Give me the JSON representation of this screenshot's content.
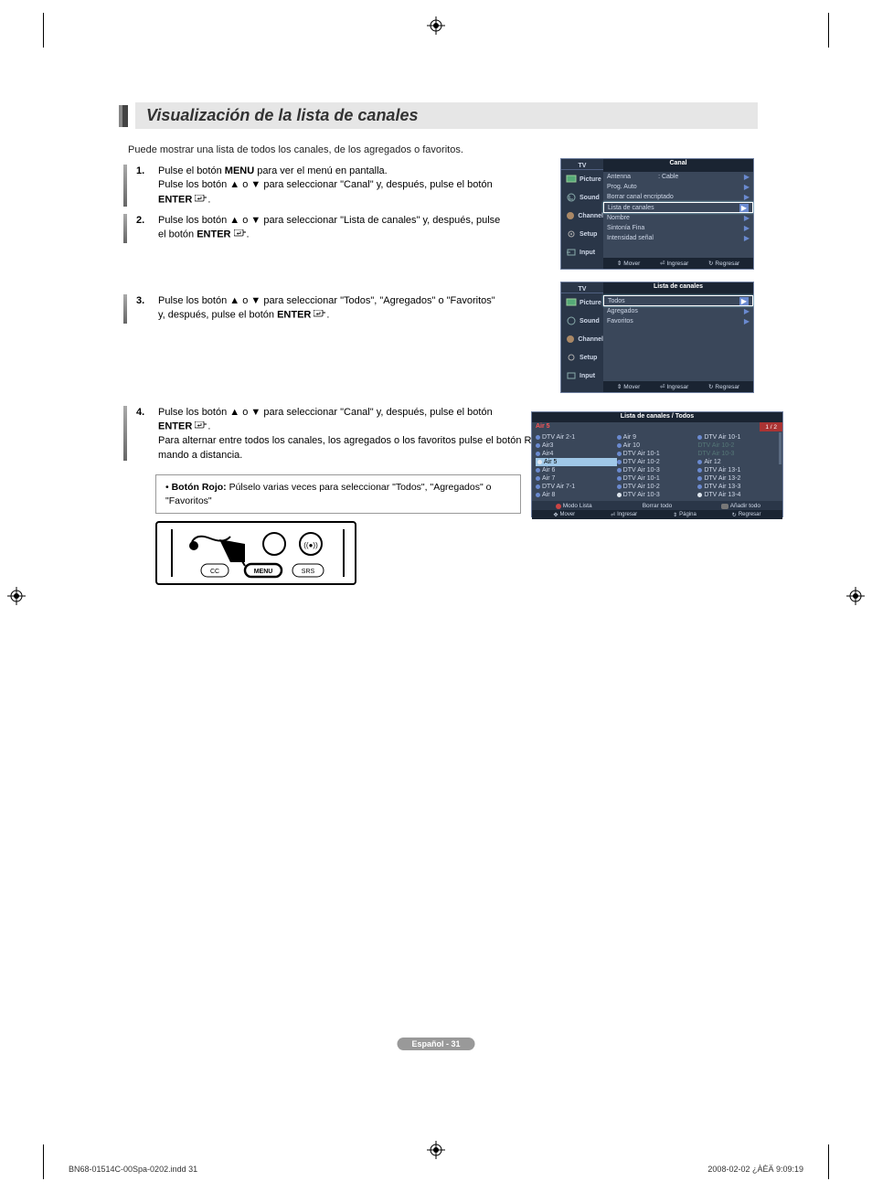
{
  "title": "Visualización de la lista de canales",
  "intro": "Puede mostrar una lista de todos los canales, de los agregados o favoritos.",
  "steps": {
    "1": {
      "line1_a": "Pulse el botón ",
      "line1_b": "MENU",
      "line1_c": " para ver el menú en pantalla.",
      "line2": "Pulse los botón ▲ o ▼ para seleccionar \"Canal\" y, después, pulse el botón",
      "line3_a": "ENTER ",
      "line3_b": "."
    },
    "2": {
      "line1": "Pulse los botón ▲ o ▼ para seleccionar \"Lista de canales\" y, después, pulse",
      "line2_a": "el botón ",
      "line2_b": "ENTER ",
      "line2_c": "."
    },
    "3": {
      "line1": "Pulse los botón ▲ o ▼ para seleccionar \"Todos\", \"Agregados\" o \"Favoritos\"",
      "line2_a": "y, después, pulse el botón ",
      "line2_b": "ENTER ",
      "line2_c": "."
    },
    "4": {
      "line1": "Pulse los botón ▲ o ▼ para seleccionar \"Canal\" y, después, pulse el botón",
      "line2_a": "ENTER ",
      "line2_b": ".",
      "line3": "Para alternar entre todos los canales, los agregados o los favoritos pulse el botón Rojo del mando a distancia."
    }
  },
  "note": {
    "label": "Botón Rojo:",
    "text": " Púlselo varias veces para seleccionar \"Todos\", \"Agregados\" o \"Favoritos\""
  },
  "remote": {
    "cc": "CC",
    "menu": "MENU",
    "srs": "SRS"
  },
  "osd": {
    "sidebar_tv": "TV",
    "sidebar": [
      {
        "label": "Picture"
      },
      {
        "label": "Sound"
      },
      {
        "label": "Channel"
      },
      {
        "label": "Setup"
      },
      {
        "label": "Input"
      }
    ],
    "footer": {
      "mover": "Mover",
      "ingresar": "Ingresar",
      "regresar": "Regresar"
    }
  },
  "osd1": {
    "title": "Canal",
    "rows": [
      {
        "label": "Antenna",
        "value": ": Cable"
      },
      {
        "label": "Prog. Auto"
      },
      {
        "label": "Borrar canal encriptado"
      },
      {
        "label": "Lista de canales",
        "highlight": true
      },
      {
        "label": "Nombre"
      },
      {
        "label": "Sintonía Fina"
      },
      {
        "label": "Intensidad señal"
      }
    ]
  },
  "osd2": {
    "title": "Lista de canales",
    "rows": [
      {
        "label": "Todos",
        "highlight": true
      },
      {
        "label": "Agregados"
      },
      {
        "label": "Favoritos"
      }
    ]
  },
  "channel_list": {
    "title": "Lista de canales / Todos",
    "current": "Air 5",
    "page": "1 / 2",
    "col1": [
      "DTV Air 2-1",
      "Air3",
      "Air4",
      "Air 5",
      "Air 6",
      "Air 7",
      "DTV Air 7-1",
      "Air 8"
    ],
    "col2": [
      "Air 9",
      "Air 10",
      "DTV Air 10-1",
      "DTV Air 10-2",
      "DTV Air 10-3",
      "DTV Air 10-1",
      "DTV Air 10-2",
      "DTV Air 10-3"
    ],
    "col3": [
      "DTV Air 10-1",
      "DTV Air 10-2",
      "DTV Air 10-3",
      "Air 12",
      "DTV Air 13-1",
      "DTV Air 13-2",
      "DTV Air 13-3",
      "DTV Air 13-4"
    ],
    "bar": {
      "modo": "Modo Lista",
      "borrar": "Borrar todo",
      "anadir": "Añadir todo"
    },
    "footer": {
      "mover": "Mover",
      "ingresar": "Ingresar",
      "pagina": "Página",
      "regresar": "Regresar"
    }
  },
  "page_footer": "Español - 31",
  "print": {
    "left": "BN68-01514C-00Spa-0202.indd   31",
    "right": "2008-02-02   ¿ÀÈÄ 9:09:19"
  }
}
